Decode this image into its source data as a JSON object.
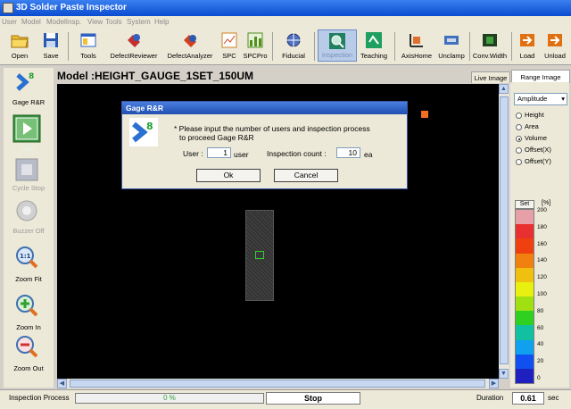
{
  "app": {
    "title": "3D Solder Paste Inspector"
  },
  "menu": [
    "User",
    "Model",
    "ModelInsp.",
    "View",
    "Tools",
    "System",
    "Help"
  ],
  "toolbar": {
    "open": "Open",
    "save": "Save",
    "tools": "Tools",
    "defect_reviewer": "DefectReviewer",
    "defect_analyzer": "DefectAnalyzer",
    "spc": "SPC",
    "spcpro": "SPCPro",
    "fiducial": "Fiducial",
    "inspection": "Inspection",
    "teaching": "Teaching",
    "axis_home": "AxisHome",
    "unclamp": "Unclamp",
    "conv_width": "Conv.Width",
    "load": "Load",
    "unload": "Unload"
  },
  "sidebar": {
    "gage_rr": "Gage R&R",
    "start": "Start",
    "cycle_stop": "Cycle Stop",
    "buzzer_off": "Buzzer Off",
    "zoom_fit": "Zoom Fit",
    "zoom_in": "Zoom In",
    "zoom_out": "Zoom Out",
    "zoom_fit_glyph": "1:1"
  },
  "model": {
    "label": "Model :",
    "name": "HEIGHT_GAUGE_1SET_150UM"
  },
  "right_panel": {
    "tabs": [
      "Live Image",
      "Range Image"
    ],
    "dropdown": "Amplitude",
    "options": [
      "Height",
      "Area",
      "Volume",
      "Offset(X)",
      "Offset(Y)"
    ],
    "selected": "Volume",
    "set_button": "Set",
    "unit": "[%]",
    "scale": [
      "200",
      "180",
      "160",
      "140",
      "120",
      "100",
      "80",
      "60",
      "40",
      "20",
      "0"
    ]
  },
  "colors": {
    "scale": [
      "#e8a0a8",
      "#e83030",
      "#f04010",
      "#f08010",
      "#f0c010",
      "#e8f010",
      "#a0e010",
      "#30d020",
      "#10c0a0",
      "#10a0f0",
      "#1050f0",
      "#2020c0"
    ]
  },
  "status": {
    "label": "Inspection Process",
    "progress_text": "0 %",
    "progress": 0,
    "stop": "Stop",
    "duration_label": "Duration",
    "duration_value": "0.61",
    "duration_unit": "sec"
  },
  "dialog": {
    "title": "Gage R&R",
    "message_line1": "* Please input the number of users and inspection process",
    "message_line2": "to proceed Gage R&R",
    "user_label": "User :",
    "user_value": "1",
    "user_unit": "user",
    "count_label": "Inspection count :",
    "count_value": "10",
    "count_unit": "ea",
    "ok": "Ok",
    "cancel": "Cancel"
  }
}
